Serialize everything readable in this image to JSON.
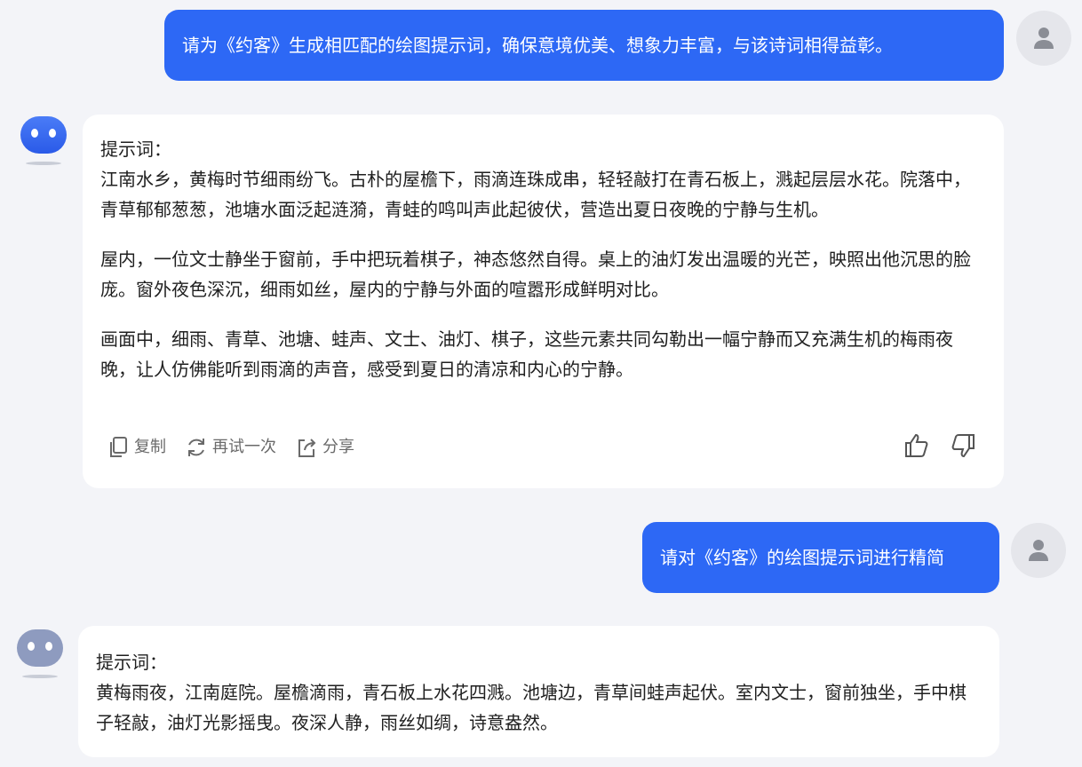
{
  "colors": {
    "accent": "#2d68f5",
    "background": "#f3f4f8",
    "bubble": "#ffffff"
  },
  "messages": [
    {
      "role": "user",
      "text": "请为《约客》生成相匹配的绘图提示词，确保意境优美、想象力丰富，与该诗词相得益彰。",
      "avatar_icon": "user-avatar-icon"
    },
    {
      "role": "assistant",
      "avatar_icon": "bot-avatar-icon",
      "label": "提示词：",
      "paragraphs": [
        "江南水乡，黄梅时节细雨纷飞。古朴的屋檐下，雨滴连珠成串，轻轻敲打在青石板上，溅起层层水花。院落中，青草郁郁葱葱，池塘水面泛起涟漪，青蛙的鸣叫声此起彼伏，营造出夏日夜晚的宁静与生机。",
        "屋内，一位文士静坐于窗前，手中把玩着棋子，神态悠然自得。桌上的油灯发出温暖的光芒，映照出他沉思的脸庞。窗外夜色深沉，细雨如丝，屋内的宁静与外面的喧嚣形成鲜明对比。",
        "画面中，细雨、青草、池塘、蛙声、文士、油灯、棋子，这些元素共同勾勒出一幅宁静而又充满生机的梅雨夜晚，让人仿佛能听到雨滴的声音，感受到夏日的清凉和内心的宁静。"
      ],
      "actions": {
        "copy": "复制",
        "retry": "再试一次",
        "share": "分享"
      }
    },
    {
      "role": "user",
      "text": "请对《约客》的绘图提示词进行精简",
      "avatar_icon": "user-avatar-icon"
    },
    {
      "role": "assistant",
      "avatar_icon": "bot-avatar-icon",
      "label": "提示词：",
      "paragraphs": [
        "黄梅雨夜，江南庭院。屋檐滴雨，青石板上水花四溅。池塘边，青草间蛙声起伏。室内文士，窗前独坐，手中棋子轻敲，油灯光影摇曳。夜深人静，雨丝如绸，诗意盎然。"
      ]
    }
  ]
}
